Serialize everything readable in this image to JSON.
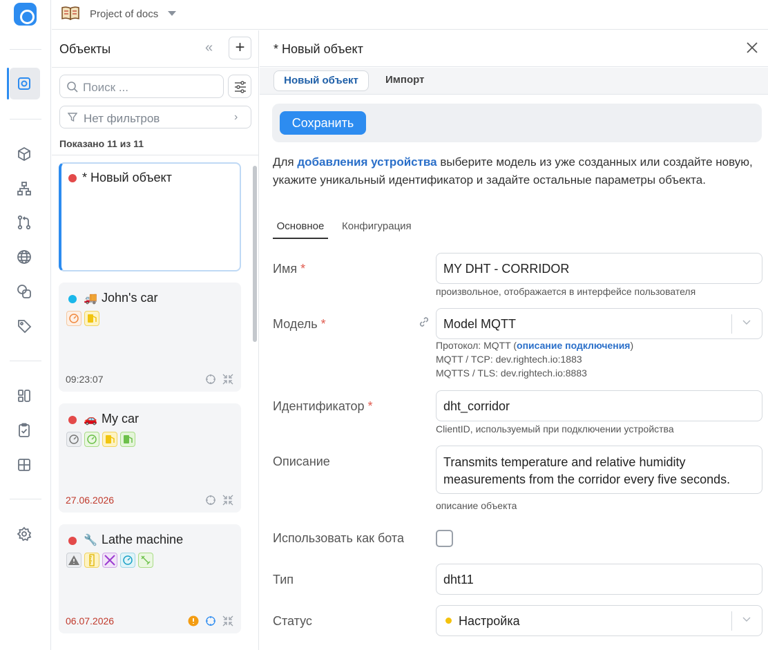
{
  "project": {
    "name": "Project of docs"
  },
  "sidebar": {
    "title": "Объекты",
    "search_placeholder": "Поиск ...",
    "filters_label": "Нет фильтров",
    "shown_label": "Показано 11 из 11",
    "items": [
      {
        "name": "* Новый объект",
        "status_color": "#e34a4a",
        "time": "",
        "selected": true
      },
      {
        "name": "John's car",
        "emoji": "🚚",
        "status_color": "#1ab7ea",
        "time": "09:23:07",
        "selected": false
      },
      {
        "name": "My car",
        "emoji": "🚗",
        "status_color": "#e34a4a",
        "time": "27.06.2026",
        "selected": false
      },
      {
        "name": "Lathe machine",
        "emoji": "🔧",
        "status_color": "#e34a4a",
        "time": "06.07.2026",
        "selected": false
      }
    ]
  },
  "main": {
    "title": "* Новый объект",
    "tabs": [
      "Новый объект",
      "Импорт"
    ],
    "save_label": "Сохранить",
    "intro_prefix": "Для ",
    "intro_link": "добавления устройства",
    "intro_suffix": " выберите модель из уже созданных или создайте новую, укажите уникальный идентификатор и задайте остальные параметры объекта.",
    "subtabs": [
      "Основное",
      "Конфигурация"
    ],
    "fields": {
      "name": {
        "label": "Имя",
        "required": "*",
        "value": "MY DHT - CORRIDOR",
        "hint": "произвольное, отображается в интерфейсе пользователя"
      },
      "model": {
        "label": "Модель",
        "required": "*",
        "value": "Model MQTT",
        "hint_prefix": "Протокол: MQTT (",
        "hint_link": "описание подключения",
        "hint_suffix": ")",
        "hint_line2": "MQTT / TCP: dev.rightech.io:1883",
        "hint_line3": "MQTTS / TLS: dev.rightech.io:8883"
      },
      "identifier": {
        "label": "Идентификатор",
        "required": "*",
        "value": "dht_corridor",
        "hint": "ClientID, используемый при подключении устройства"
      },
      "description": {
        "label": "Описание",
        "value": "Transmits temperature and relative humidity measurements from the corridor every five seconds.",
        "hint": "описание объекта"
      },
      "bot": {
        "label": "Использовать как бота",
        "checked": false
      },
      "type": {
        "label": "Тип",
        "value": "dht11"
      },
      "status": {
        "label": "Статус",
        "value": "Настройка",
        "color": "#f4c20d"
      }
    }
  }
}
